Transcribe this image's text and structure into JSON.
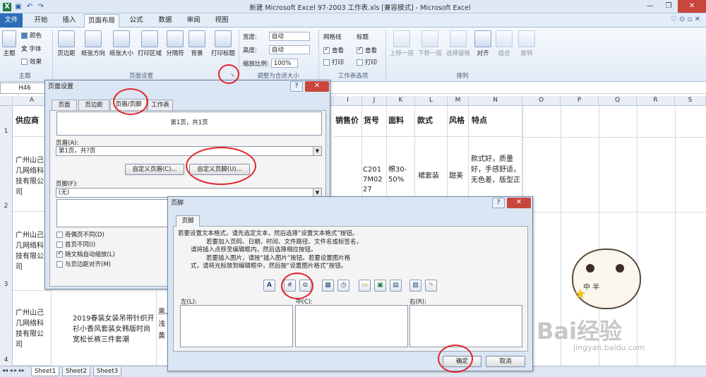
{
  "window": {
    "title": "新建 Microsoft Excel 97-2003 工作表.xls  [兼容模式]  -  Microsoft Excel"
  },
  "ribbon_tabs": [
    "文件",
    "开始",
    "插入",
    "页面布局",
    "公式",
    "数据",
    "审阅",
    "视图"
  ],
  "ribbon": {
    "theme": {
      "main": "主题",
      "colors": "颜色",
      "fonts": "字体",
      "effects": "效果",
      "group": "主题"
    },
    "page_setup": {
      "margins": "页边距",
      "orientation": "纸张方向",
      "size": "纸张大小",
      "print_area": "打印区域",
      "breaks": "分隔符",
      "background": "背景",
      "print_titles": "打印标题",
      "group": "页面设置"
    },
    "scale": {
      "width_label": "宽度:",
      "width_val": "自动",
      "height_label": "高度:",
      "height_val": "自动",
      "scale_label": "缩放比例:",
      "scale_val": "100%",
      "group": "调整为合适大小"
    },
    "sheet_options": {
      "gridlines": "网格线",
      "headings": "标题",
      "view": "查看",
      "print": "打印",
      "group": "工作表选项"
    },
    "arrange": {
      "forward": "上移一层",
      "backward": "下移一层",
      "pane": "选择窗格",
      "align": "对齐",
      "groupbtn": "组合",
      "rotate": "旋转",
      "group": "排列"
    }
  },
  "namebox": "H46",
  "columns": [
    "A",
    "I",
    "J",
    "K",
    "L",
    "M",
    "N",
    "O",
    "P",
    "Q",
    "R",
    "S"
  ],
  "rows": [
    "1",
    "2",
    "3",
    "4"
  ],
  "sheet": {
    "a1": "供应商",
    "i1": "销售价",
    "j1": "货号",
    "k1": "面料",
    "l1": "款式",
    "m1": "风格",
    "n1": "特点",
    "a2": "广州山己几网络科技有限公司",
    "j2": "C2017M0227",
    "k2": "棉30-50%",
    "l2": "裙套装",
    "m2": "甜美",
    "n2": "款式好，质量好，手感舒适，无色差，版型正",
    "a3": "广州山己几网络科技有限公司",
    "a4": "广州山己几网络科技有限公司",
    "b4": "2019春装女装吊带针织开衫小香风套装女韩版时尚宽松长裤三件套潮",
    "c4": "黑、浅黄"
  },
  "sheet_tabs": [
    "Sheet1",
    "Sheet2",
    "Sheet3"
  ],
  "page_setup_dialog": {
    "title": "页面设置",
    "tabs": [
      "页面",
      "页边距",
      "页眉/页脚",
      "工作表"
    ],
    "preview": "第1页，共1页",
    "header_label": "页眉(A):",
    "header_value": "第1页，共?页",
    "custom_header": "自定义页眉(C)...",
    "custom_footer": "自定义页脚(U)...",
    "footer_label": "页脚(F):",
    "footer_value": "(无)",
    "chk_odd_even": "奇偶页不同(D)",
    "chk_first": "首页不同(I)",
    "chk_scale": "随文档自动缩放(L)",
    "chk_align": "与页边距对齐(M)"
  },
  "footer_dialog": {
    "title": "页脚",
    "tab": "页脚",
    "instructions": [
      "若要设置文本格式，请先选定文本，然后选择“设置文本格式”按钮。",
      "若要加入页码、日期、时间、文件路径、文件名或标签名，",
      "请将插入点移至编辑框内，然后选择相应按钮。",
      "若要插入图片，请按“插入图片”按钮。若要设置图片格",
      "式，请将光标放到编辑框中，然后按“设置图片格式”按钮。"
    ],
    "left_label": "左(L):",
    "center_label": "中(C):",
    "right_label": "右(R):",
    "ok": "确定",
    "cancel": "取消"
  },
  "watermark": {
    "brand": "Bai经验",
    "url": "jingyan.baidu.com",
    "sticker": "中 半"
  }
}
